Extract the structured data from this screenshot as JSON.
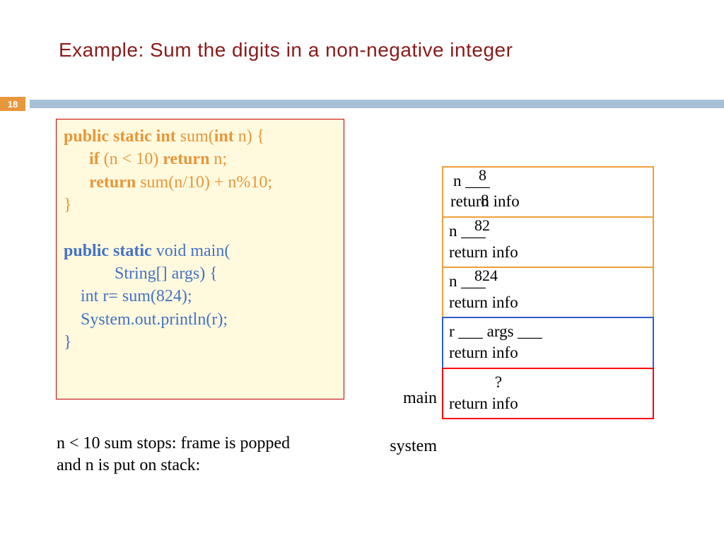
{
  "title": "Example: Sum the digits in a non-negative integer",
  "slide_number": "18",
  "code": {
    "l1_kw": "public static int ",
    "l1_fn": "sum(",
    "l1_kw2": "int ",
    "l1_tail": "n) {",
    "l2_kw": "if ",
    "l2_cond": "(n < 10) ",
    "l2_kw2": "return ",
    "l2_tail": "n;",
    "l3_kw": "return ",
    "l3_tail": "sum(n/10)  +  n%10;",
    "l4": "}",
    "l5_kw": "public static ",
    "l5_tail": "void main(",
    "l6_tail": "String[] args) {",
    "l7": "int r= sum(824);",
    "l8": "System.out.println(r);",
    "l9": "}"
  },
  "note_line1": "n < 10 sum stops: frame is popped",
  "note_line2": "and n is put on stack:",
  "labels": {
    "main": "main",
    "system": "system"
  },
  "stack": {
    "popped_value": "8",
    "frames": [
      {
        "var": "n ___",
        "val": "8",
        "ret": "return info"
      },
      {
        "var": "n ___",
        "val": "82",
        "ret": "return info"
      },
      {
        "var": "n ___",
        "val": "824",
        "ret": "return info"
      },
      {
        "line1": "r ___  args ___",
        "ret": "return info"
      },
      {
        "line1": "?",
        "ret": "return info"
      }
    ]
  }
}
